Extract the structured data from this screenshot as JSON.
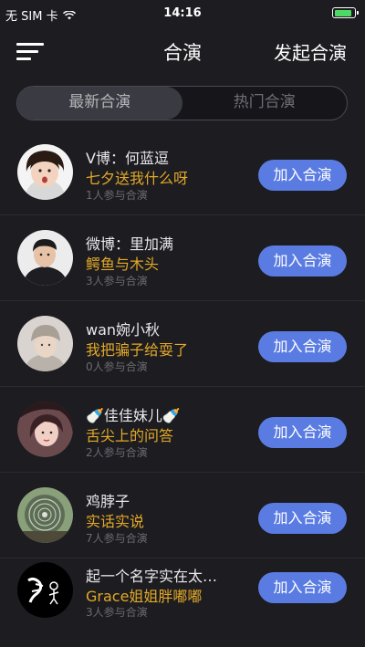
{
  "status_bar": {
    "carrier": "无 SIM 卡",
    "time": "14:16",
    "battery_level": 0.9
  },
  "nav": {
    "title": "合演",
    "action_label": "发起合演",
    "menu_icon": "hamburger-menu-icon"
  },
  "tabs": [
    {
      "label": "最新合演",
      "active": true
    },
    {
      "label": "热门合演",
      "active": false
    }
  ],
  "list": [
    {
      "name": "V博：何蓝逗",
      "song": "七夕送我什么呀",
      "count": "1人参与合演",
      "button": "加入合演"
    },
    {
      "name": "微博：里加满",
      "song": "鳄鱼与木头",
      "count": "3人参与合演",
      "button": "加入合演"
    },
    {
      "name": "wan婉小秋",
      "song": "我把骗子给耍了",
      "count": "0人参与合演",
      "button": "加入合演"
    },
    {
      "name": "🍼佳佳妹儿🍼",
      "song": "舌尖上的问答",
      "count": "2人参与合演",
      "button": "加入合演"
    },
    {
      "name": "鸡脖子",
      "song": "实话实说",
      "count": "7人参与合演",
      "button": "加入合演"
    },
    {
      "name": "起一个名字实在太…",
      "song": "Grace姐姐胖嘟嘟",
      "count": "3人参与合演",
      "button": "加入合演"
    }
  ],
  "colors": {
    "background": "#1c1c21",
    "accent_button": "#5a7ce2",
    "song_title": "#e3a927"
  }
}
